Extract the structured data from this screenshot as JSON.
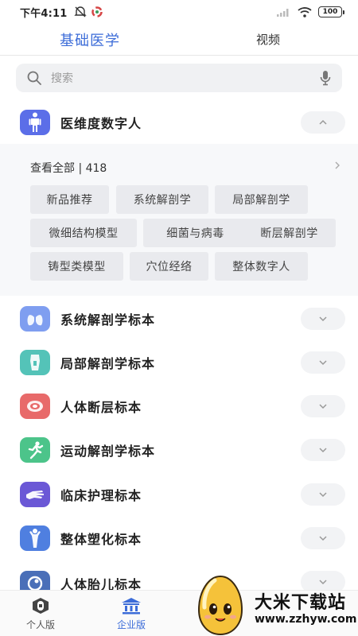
{
  "status_bar": {
    "time": "下午4:11",
    "battery": "100"
  },
  "top_tabs": [
    {
      "label": "基础医学",
      "active": true
    },
    {
      "label": "视频",
      "active": false
    }
  ],
  "search": {
    "placeholder": "搜索"
  },
  "expanded_category": {
    "label": "医维度数字人",
    "icon": "human-body-icon",
    "view_all": "查看全部 | 418",
    "tags": [
      "新品推荐",
      "系统解剖学",
      "局部解剖学",
      "微细结构模型",
      "细菌与病毒",
      "断层解剖学",
      "铸型类模型",
      "穴位经络",
      "整体数字人"
    ]
  },
  "categories": [
    {
      "label": "系统解剖学标本",
      "icon": "lungs-icon",
      "color": "#7f9ef0"
    },
    {
      "label": "局部解剖学标本",
      "icon": "torso-icon",
      "color": "#54c3b8"
    },
    {
      "label": "人体断层标本",
      "icon": "cross-section-icon",
      "color": "#e86a6a"
    },
    {
      "label": "运动解剖学标本",
      "icon": "running-icon",
      "color": "#4cc48a"
    },
    {
      "label": "临床护理标本",
      "icon": "hand-icon",
      "color": "#6b58d6"
    },
    {
      "label": "整体塑化标本",
      "icon": "body-figure-icon",
      "color": "#4f7fe0"
    },
    {
      "label": "人体胎儿标本",
      "icon": "fetus-icon",
      "color": "#4a6fb8"
    }
  ],
  "bottom_nav": [
    {
      "label": "个人版",
      "icon": "personal-icon",
      "active": false
    },
    {
      "label": "企业版",
      "icon": "enterprise-icon",
      "active": true
    }
  ],
  "watermark": {
    "title": "大米下载站",
    "url": "www.zzhyw.com"
  },
  "colors": {
    "accent": "#3c6cd8",
    "human_icon_bg": "#5b6ee8"
  }
}
